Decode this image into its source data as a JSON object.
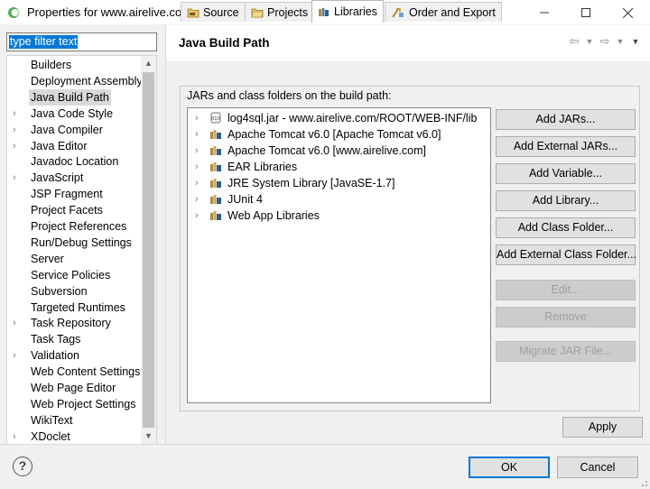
{
  "window": {
    "title": "Properties for www.airelive.com"
  },
  "filter": {
    "value": "type filter text"
  },
  "tree": [
    {
      "label": "Builders",
      "arrow": false,
      "selected": false
    },
    {
      "label": "Deployment Assembly",
      "arrow": false,
      "selected": false
    },
    {
      "label": "Java Build Path",
      "arrow": false,
      "selected": true
    },
    {
      "label": "Java Code Style",
      "arrow": true,
      "selected": false
    },
    {
      "label": "Java Compiler",
      "arrow": true,
      "selected": false
    },
    {
      "label": "Java Editor",
      "arrow": true,
      "selected": false
    },
    {
      "label": "Javadoc Location",
      "arrow": false,
      "selected": false
    },
    {
      "label": "JavaScript",
      "arrow": true,
      "selected": false
    },
    {
      "label": "JSP Fragment",
      "arrow": false,
      "selected": false
    },
    {
      "label": "Project Facets",
      "arrow": false,
      "selected": false
    },
    {
      "label": "Project References",
      "arrow": false,
      "selected": false
    },
    {
      "label": "Run/Debug Settings",
      "arrow": false,
      "selected": false
    },
    {
      "label": "Server",
      "arrow": false,
      "selected": false
    },
    {
      "label": "Service Policies",
      "arrow": false,
      "selected": false
    },
    {
      "label": "Subversion",
      "arrow": false,
      "selected": false
    },
    {
      "label": "Targeted Runtimes",
      "arrow": false,
      "selected": false
    },
    {
      "label": "Task Repository",
      "arrow": true,
      "selected": false
    },
    {
      "label": "Task Tags",
      "arrow": false,
      "selected": false
    },
    {
      "label": "Validation",
      "arrow": true,
      "selected": false
    },
    {
      "label": "Web Content Settings",
      "arrow": false,
      "selected": false
    },
    {
      "label": "Web Page Editor",
      "arrow": false,
      "selected": false
    },
    {
      "label": "Web Project Settings",
      "arrow": false,
      "selected": false
    },
    {
      "label": "WikiText",
      "arrow": false,
      "selected": false
    },
    {
      "label": "XDoclet",
      "arrow": true,
      "selected": false
    }
  ],
  "page": {
    "title": "Java Build Path"
  },
  "tabs": [
    {
      "label": "Source",
      "icon": "source-folder-icon",
      "active": false
    },
    {
      "label": "Projects",
      "icon": "project-folder-icon",
      "active": false
    },
    {
      "label": "Libraries",
      "icon": "libraries-icon",
      "active": true
    },
    {
      "label": "Order and Export",
      "icon": "order-export-icon",
      "active": false
    }
  ],
  "libraries": {
    "heading": "JARs and class folders on the build path:",
    "items": [
      {
        "label": "log4sql.jar - www.airelive.com/ROOT/WEB-INF/lib",
        "icon": "jar-icon"
      },
      {
        "label": "Apache Tomcat v6.0 [Apache Tomcat v6.0]",
        "icon": "library-icon"
      },
      {
        "label": "Apache Tomcat v6.0 [www.airelive.com]",
        "icon": "library-icon"
      },
      {
        "label": "EAR Libraries",
        "icon": "library-icon"
      },
      {
        "label": "JRE System Library [JavaSE-1.7]",
        "icon": "library-icon"
      },
      {
        "label": "JUnit 4",
        "icon": "library-icon"
      },
      {
        "label": "Web App Libraries",
        "icon": "library-icon"
      }
    ]
  },
  "buttons": {
    "add_jars": "Add JARs...",
    "add_external_jars": "Add External JARs...",
    "add_variable": "Add Variable...",
    "add_library": "Add Library...",
    "add_class_folder": "Add Class Folder...",
    "add_external_class_folder": "Add External Class Folder...",
    "edit": "Edit...",
    "remove": "Remove",
    "migrate_jar": "Migrate JAR File...",
    "apply": "Apply",
    "ok": "OK",
    "cancel": "Cancel",
    "help": "?"
  }
}
